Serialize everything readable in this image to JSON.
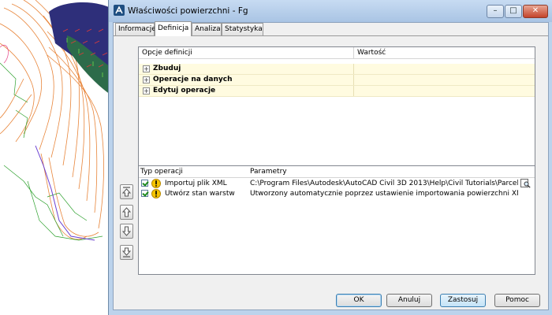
{
  "window": {
    "title": "Właściwości powierzchni - Fg"
  },
  "tabs": [
    {
      "label": "Informacje",
      "active": false
    },
    {
      "label": "Definicja",
      "active": true
    },
    {
      "label": "Analiza",
      "active": false
    },
    {
      "label": "Statystyka",
      "active": false
    }
  ],
  "definition_grid": {
    "headers": {
      "options": "Opcje definicji",
      "value": "Wartość"
    },
    "rows": [
      {
        "label": "Zbuduj"
      },
      {
        "label": "Operacje na danych"
      },
      {
        "label": "Edytuj operacje"
      }
    ]
  },
  "operations": {
    "headers": {
      "type": "Typ operacji",
      "params": "Parametry"
    },
    "rows": [
      {
        "name": "Importuj plik XML",
        "params": "C:\\Program Files\\Autodesk\\AutoCAD Civil 3D 2013\\Help\\Civil Tutorials\\Parcel Boun...",
        "checked": true
      },
      {
        "name": "Utwórz stan warstw",
        "params": "Utworzony automatycznie poprzez ustawienie importowania powierzchni XML",
        "checked": true
      }
    ]
  },
  "buttons": {
    "ok": "OK",
    "cancel": "Anuluj",
    "apply": "Zastosuj",
    "help": "Pomoc"
  },
  "colors": {
    "titlebar": "#b9d1ea",
    "grid_row": "#fffbe0",
    "warning": "#f5c400",
    "check": "#1d8a1d"
  }
}
